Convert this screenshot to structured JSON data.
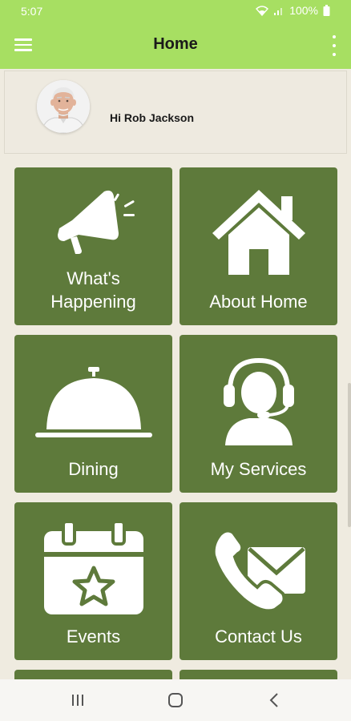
{
  "status_bar": {
    "time": "5:07",
    "battery": "100%"
  },
  "app_bar": {
    "title": "Home"
  },
  "profile": {
    "greeting": "Hi Rob Jackson"
  },
  "tiles": [
    {
      "label_line1": "What's",
      "label_line2": "Happening",
      "icon": "megaphone-icon"
    },
    {
      "label": "About Home",
      "icon": "house-icon"
    },
    {
      "label": "Dining",
      "icon": "cloche-icon"
    },
    {
      "label": "My Services",
      "icon": "headset-person-icon"
    },
    {
      "label": "Events",
      "icon": "calendar-star-icon"
    },
    {
      "label": "Contact Us",
      "icon": "phone-envelope-icon"
    }
  ],
  "colors": {
    "accent": "#a7df62",
    "tile": "#5e7a3b",
    "background": "#efebe0"
  }
}
